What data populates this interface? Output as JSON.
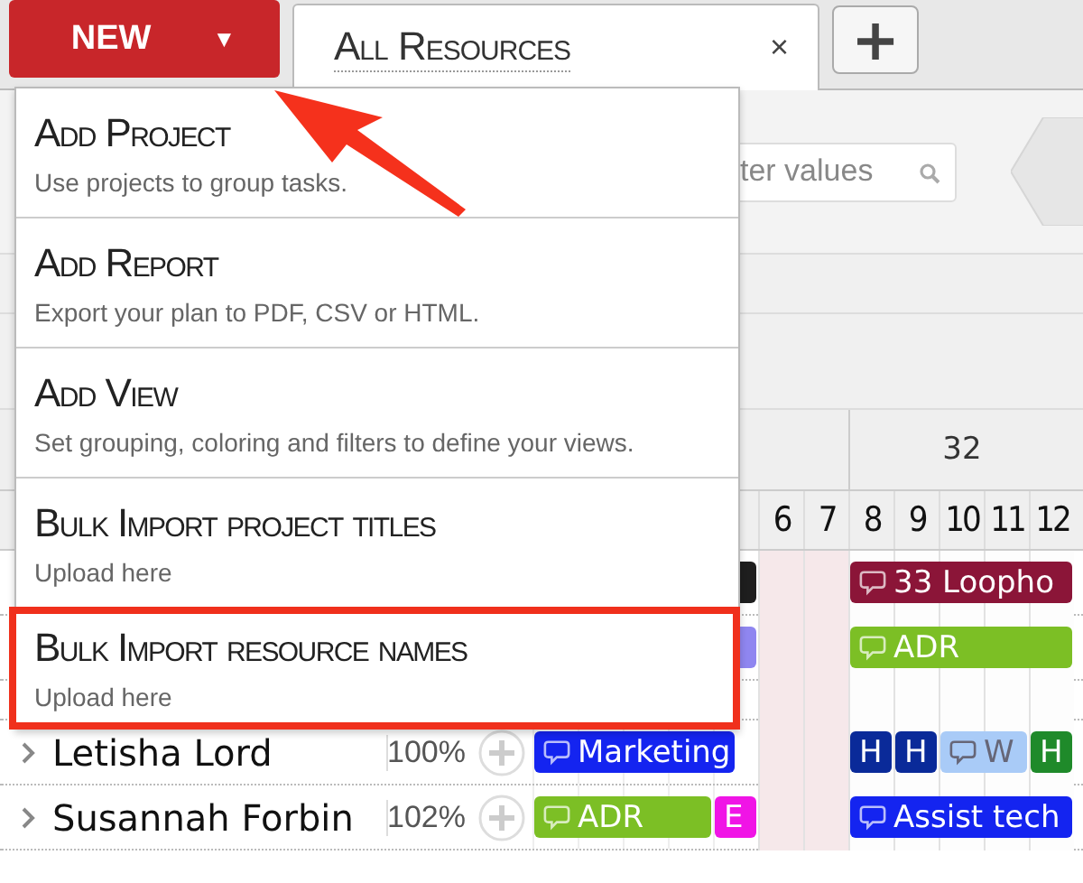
{
  "new_button": {
    "label": "NEW",
    "caret": "▼"
  },
  "tabs": [
    {
      "label": "All Resources",
      "selected": true,
      "close": "×"
    }
  ],
  "add_tab_button": {
    "label": "+"
  },
  "filter": {
    "placeholder": "ter values"
  },
  "week": {
    "label": "32"
  },
  "days": [
    {
      "label": "6",
      "weekend": true
    },
    {
      "label": "7",
      "weekend": true
    },
    {
      "label": "8",
      "weekend": false
    },
    {
      "label": "9",
      "weekend": false
    },
    {
      "label": "10",
      "weekend": false
    },
    {
      "label": "11",
      "weekend": false
    },
    {
      "label": "12",
      "weekend": false
    }
  ],
  "rows": [
    {
      "bars": [
        {
          "color": "#1e1e1e"
        },
        {
          "text": "33 Loopho",
          "color": "#8b1538",
          "icon": true
        }
      ]
    },
    {
      "bars": [
        {
          "color": "#8f86f0"
        },
        {
          "text": "ADR",
          "color": "#7cbf25",
          "icon": true
        }
      ]
    },
    {
      "name": "Letisha Lord",
      "load": "100%",
      "bars": [
        {
          "text": "Marketing",
          "color": "#1424f0",
          "icon": true
        },
        {
          "text": "H",
          "color": "#0a2a99",
          "icon": false
        },
        {
          "text": "H",
          "color": "#0a2a99",
          "icon": false
        },
        {
          "text": "W",
          "color": "#a9cbf7",
          "icon": true
        },
        {
          "text": "H",
          "color": "#1f8a2a",
          "icon": false
        }
      ]
    },
    {
      "name": "Susannah Forbin",
      "load": "102%",
      "bars": [
        {
          "text": "ADR",
          "color": "#7cbf25",
          "icon": true
        },
        {
          "text": "E",
          "color": "#f014e6",
          "icon": false
        },
        {
          "text": "Assist tech",
          "color": "#1424f0",
          "icon": true
        }
      ]
    }
  ],
  "menu": [
    {
      "title": "Add Project",
      "description": "Use projects to group tasks.",
      "highlighted": false
    },
    {
      "title": "Add Report",
      "description": "Export your plan to PDF, CSV or HTML.",
      "highlighted": false
    },
    {
      "title": "Add View",
      "description": "Set grouping, coloring and filters to define your views.",
      "highlighted": false
    },
    {
      "title": "Bulk Import project titles",
      "description": "Upload here",
      "highlighted": false
    },
    {
      "title": "Bulk Import resource names",
      "description": "Upload here",
      "highlighted": true
    }
  ]
}
